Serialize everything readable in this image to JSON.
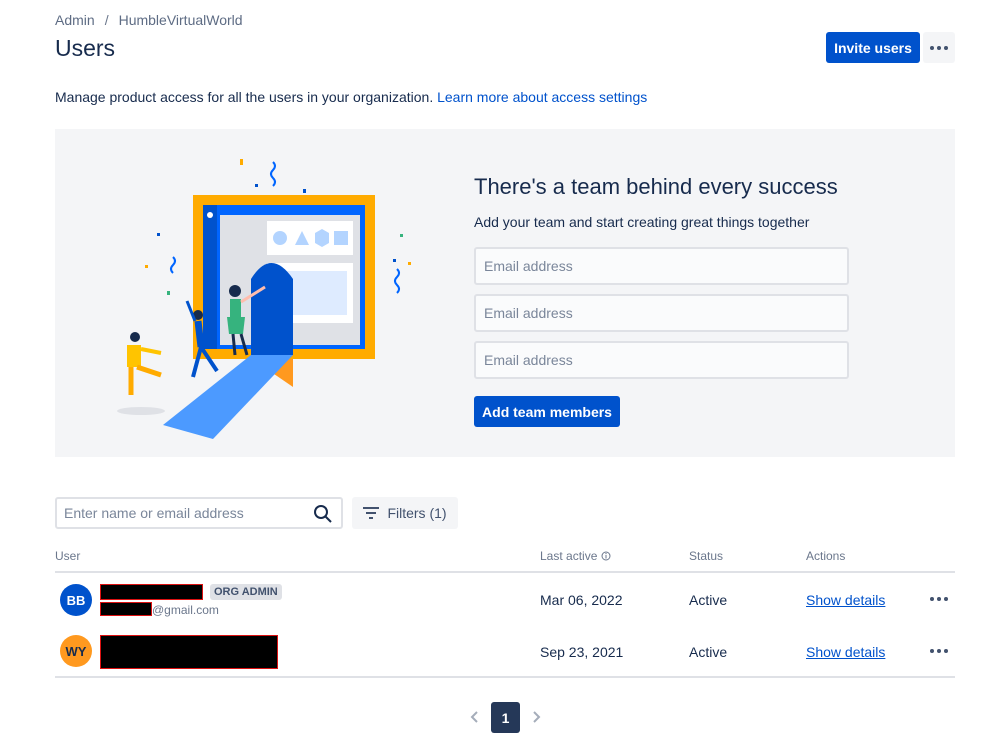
{
  "breadcrumb": {
    "root": "Admin",
    "separator": "/",
    "org": "HumbleVirtualWorld"
  },
  "header": {
    "title": "Users",
    "invite_label": "Invite users"
  },
  "description": {
    "text": "Manage product access for all the users in your organization.",
    "link": "Learn more about access settings"
  },
  "banner": {
    "title": "There's a team behind every success",
    "subtitle": "Add your team and start creating great things together",
    "email_placeholder": "Email address",
    "add_label": "Add team members"
  },
  "search": {
    "placeholder": "Enter name or email address"
  },
  "filters": {
    "label": "Filters (1)"
  },
  "table": {
    "columns": {
      "user": "User",
      "last_active": "Last active",
      "status": "Status",
      "actions": "Actions"
    },
    "rows": [
      {
        "initials": "BB",
        "avatar_color": "#0052cc",
        "badge": "ORG ADMIN",
        "email_suffix": "@gmail.com",
        "last_active": "Mar 06, 2022",
        "status": "Active",
        "action": "Show details"
      },
      {
        "initials": "WY",
        "avatar_color": "#ff991f",
        "last_active": "Sep 23, 2021",
        "status": "Active",
        "action": "Show details"
      }
    ]
  },
  "pagination": {
    "current": "1"
  },
  "colors": {
    "primary": "#0052cc",
    "text": "#172b4d",
    "subtle": "#6b778c",
    "banner_bg": "#f4f5f7"
  },
  "icons": [
    "search-icon",
    "filter-icon",
    "info-icon",
    "more-icon",
    "chevron-left-icon",
    "chevron-right-icon"
  ]
}
